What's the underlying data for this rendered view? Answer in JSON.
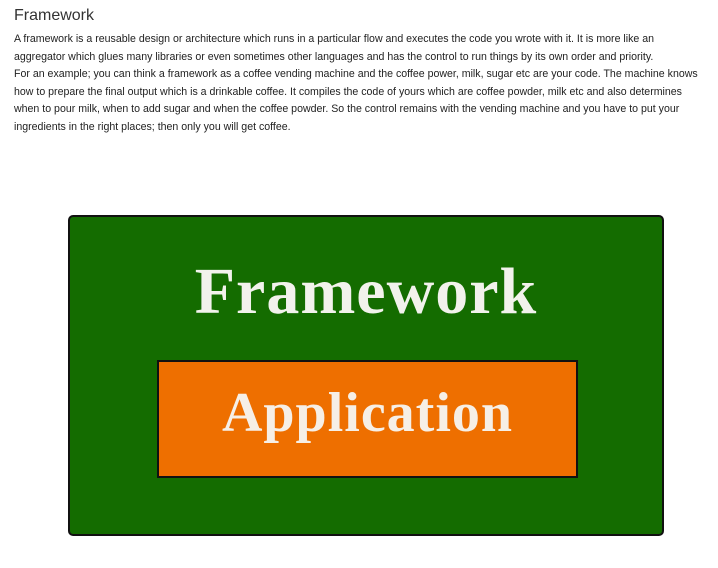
{
  "section": {
    "title": "Framework",
    "paragraphs": [
      "A framework is a reusable design or architecture which runs in a particular flow and executes the code you wrote with it. It is more like an aggregator which glues many libraries or even sometimes other languages and has the control to run things by its own order and priority.",
      "For an example; you can think a framework as a coffee vending machine and the coffee power, milk, sugar etc are your code. The machine knows how to prepare the final output which is a drinkable coffee. It compiles the code of yours which are coffee powder, milk etc and also determines when to pour milk, when to add sugar and when the coffee powder. So the control remains with the vending machine and you have to put your ingredients in the right places; then only you will get coffee."
    ]
  },
  "diagram": {
    "outer_label": "Framework",
    "inner_label": "Application",
    "colors": {
      "outer_fill": "#146c00",
      "inner_fill": "#ee6f00",
      "label_text": "#f2f2ec",
      "border": "#111111"
    }
  }
}
